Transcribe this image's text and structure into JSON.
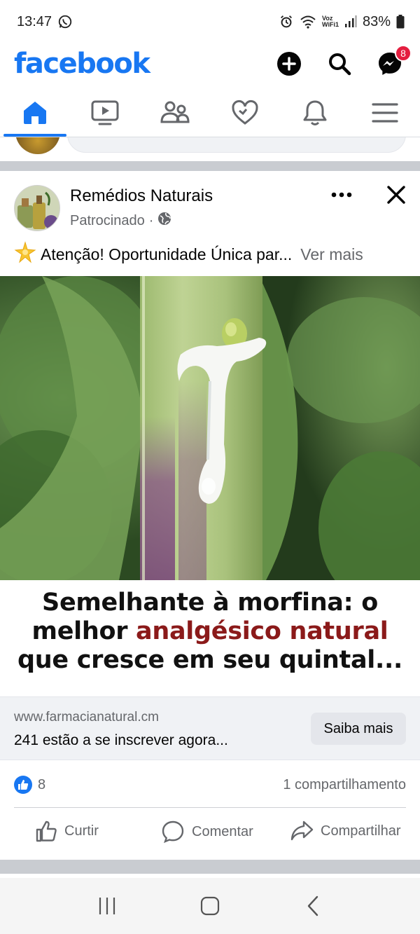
{
  "status_bar": {
    "time": "13:47",
    "battery": "83%",
    "network_label_top": "Voz",
    "network_label_bottom": "WiFi1"
  },
  "header": {
    "logo": "facebook",
    "messenger_badge": "8"
  },
  "nav_tabs": [
    {
      "name": "home",
      "active": true
    },
    {
      "name": "watch",
      "active": false
    },
    {
      "name": "groups",
      "active": false
    },
    {
      "name": "dating",
      "active": false
    },
    {
      "name": "notifications",
      "active": false
    },
    {
      "name": "menu",
      "active": false
    }
  ],
  "post": {
    "page_name": "Remédios Naturais",
    "sponsored_label": "Patrocinado",
    "meta_separator": "·",
    "text": "Atenção! Oportunidade Única par...",
    "see_more": "Ver mais",
    "headline_part1": "Semelhante à morfina: o",
    "headline_part2_pre": "melhor ",
    "headline_accent": "analgésico natural",
    "headline_part3": "que cresce em seu quintal...",
    "link_domain": "www.farmacianatural.cm",
    "link_description": "241 estão a se inscrever agora...",
    "cta_label": "Saiba mais",
    "reaction_count": "8",
    "shares": "1 compartilhamento",
    "actions": {
      "like": "Curtir",
      "comment": "Comentar",
      "share": "Compartilhar"
    }
  },
  "colors": {
    "brand": "#1877f2",
    "headline_accent": "#8b1a1a",
    "badge": "#e41e3f"
  }
}
